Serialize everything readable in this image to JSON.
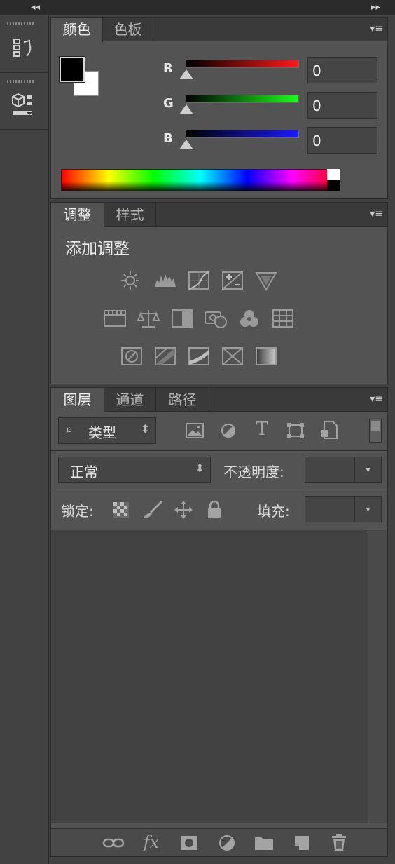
{
  "dock": {
    "collapse_left": "◂◂",
    "collapse_right": "▸▸",
    "items": [
      {
        "name": "history-icon"
      },
      {
        "name": "3d-properties-icon"
      }
    ]
  },
  "color_panel": {
    "tabs": [
      {
        "label": "颜色"
      },
      {
        "label": "色板"
      }
    ],
    "menu_icon": "▾≡",
    "channels": [
      {
        "label": "R",
        "value": "0",
        "color": "#ff1a1a"
      },
      {
        "label": "G",
        "value": "0",
        "color": "#1aff1a"
      },
      {
        "label": "B",
        "value": "0",
        "color": "#1a1aff"
      }
    ],
    "foreground": "#000000",
    "background": "#ffffff"
  },
  "adjustments_panel": {
    "tabs": [
      {
        "label": "调整"
      },
      {
        "label": "样式"
      }
    ],
    "menu_icon": "▾≡",
    "title": "添加调整",
    "icons": [
      "brightness-contrast-icon",
      "levels-icon",
      "curves-icon",
      "exposure-icon",
      "vibrance-icon",
      "hue-saturation-icon",
      "color-balance-icon",
      "black-white-icon",
      "photo-filter-icon",
      "channel-mixer-icon",
      "color-lookup-icon",
      "invert-icon",
      "posterize-icon",
      "threshold-icon",
      "selective-color-icon",
      "gradient-map-icon"
    ]
  },
  "layers_panel": {
    "tabs": [
      {
        "label": "图层"
      },
      {
        "label": "通道"
      },
      {
        "label": "路径"
      }
    ],
    "menu_icon": "▾≡",
    "filter": {
      "label": "类型",
      "icon": "⌕",
      "arrow": "⬍"
    },
    "blend_mode": {
      "value": "正常",
      "arrow": "⬍"
    },
    "opacity_label": "不透明度:",
    "opacity_value": "",
    "lock_label": "锁定:",
    "fill_label": "填充:",
    "fill_value": "",
    "dropdown_arrow": "▾",
    "footer_icons": [
      {
        "name": "link-layers-icon",
        "glyph": "⊂⊃"
      },
      {
        "name": "fx-icon",
        "glyph": "fx"
      },
      {
        "name": "layer-mask-icon",
        "glyph": "▣"
      },
      {
        "name": "adjustment-layer-icon",
        "glyph": "◐"
      },
      {
        "name": "folder-icon",
        "glyph": "▬"
      },
      {
        "name": "new-layer-icon",
        "glyph": "▟"
      },
      {
        "name": "trash-icon",
        "glyph": "🗑"
      }
    ]
  }
}
